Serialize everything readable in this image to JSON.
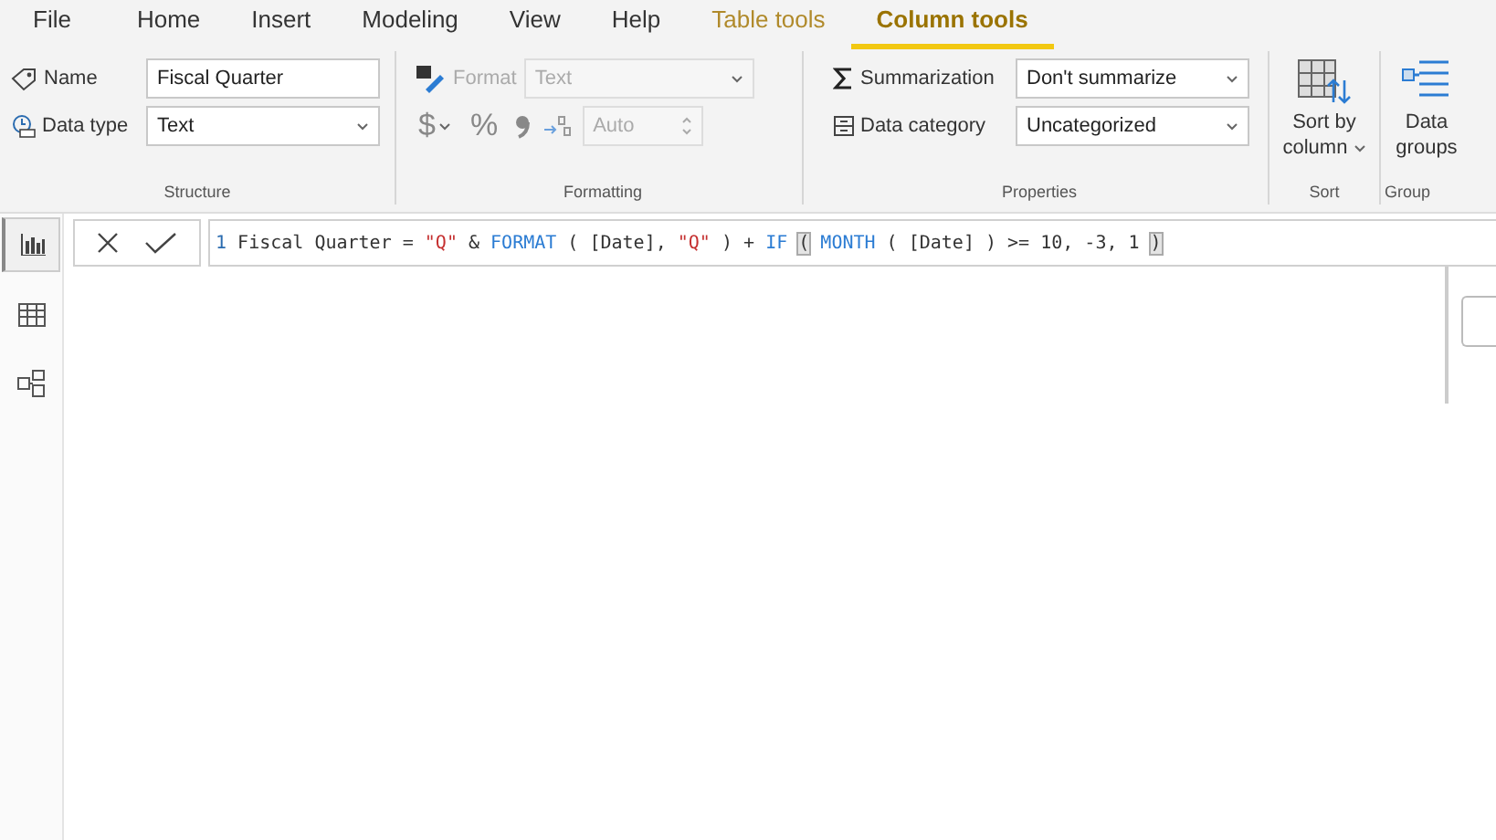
{
  "ribbon_tabs": [
    {
      "label": "File",
      "kind": "normal",
      "selected": false
    },
    {
      "label": "Home",
      "kind": "normal",
      "selected": false
    },
    {
      "label": "Insert",
      "kind": "normal",
      "selected": false
    },
    {
      "label": "Modeling",
      "kind": "normal",
      "selected": false
    },
    {
      "label": "View",
      "kind": "normal",
      "selected": false
    },
    {
      "label": "Help",
      "kind": "normal",
      "selected": false
    },
    {
      "label": "Table tools",
      "kind": "contextual",
      "selected": false
    },
    {
      "label": "Column tools",
      "kind": "contextual",
      "selected": true
    }
  ],
  "structure": {
    "label": "Structure",
    "name_label": "Name",
    "name_value": "Fiscal Quarter",
    "data_type_label": "Data type",
    "data_type_value": "Text"
  },
  "formatting": {
    "label": "Formatting",
    "disabled": true,
    "format_label": "Format",
    "format_value": "Text",
    "currency": "$",
    "percent": "%",
    "decimals_value": "Auto"
  },
  "properties": {
    "label": "Properties",
    "summarization_label": "Summarization",
    "summarization_value": "Don't summarize",
    "category_label": "Data category",
    "category_value": "Uncategorized"
  },
  "sort": {
    "label": "Sort",
    "button": "Sort by column"
  },
  "groups": {
    "label": "Group",
    "button": "Data groups"
  },
  "rail": [
    {
      "kind": "report",
      "selected": true
    },
    {
      "kind": "data",
      "selected": false
    },
    {
      "kind": "model",
      "selected": false
    }
  ],
  "formula": {
    "tokens": [
      {
        "text": "1",
        "kind": "line"
      },
      {
        "text": " Fiscal Quarter = ",
        "kind": "plain"
      },
      {
        "text": "\"Q\"",
        "kind": "string"
      },
      {
        "text": " & ",
        "kind": "plain"
      },
      {
        "text": "FORMAT",
        "kind": "function"
      },
      {
        "text": " ( [Date], ",
        "kind": "plain"
      },
      {
        "text": "\"Q\"",
        "kind": "string"
      },
      {
        "text": " ) + ",
        "kind": "plain"
      },
      {
        "text": "IF ",
        "kind": "function"
      },
      {
        "text": "(",
        "kind": "match"
      },
      {
        "text": " MONTH",
        "kind": "function"
      },
      {
        "text": " ( [Date] ) >= 10, -3, 1 ",
        "kind": "plain"
      },
      {
        "text": ")",
        "kind": "match"
      }
    ]
  }
}
